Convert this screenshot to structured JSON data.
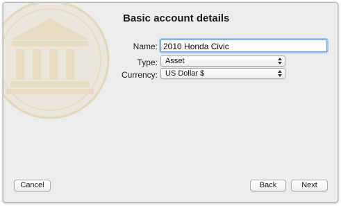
{
  "header": {
    "title": "Basic account details"
  },
  "form": {
    "name": {
      "label": "Name:",
      "value": "2010 Honda Civic"
    },
    "type": {
      "label": "Type:",
      "selected": "Asset"
    },
    "currency": {
      "label": "Currency:",
      "selected": "US Dollar $"
    }
  },
  "buttons": {
    "cancel": "Cancel",
    "back": "Back",
    "next": "Next"
  },
  "icons": {
    "watermark": "bank-building-icon",
    "popup_arrows": "up-down-arrows-icon"
  },
  "colors": {
    "window_bg": "#ececec",
    "focus_ring": "#a6c5ea",
    "watermark": "#e6ddc6"
  }
}
